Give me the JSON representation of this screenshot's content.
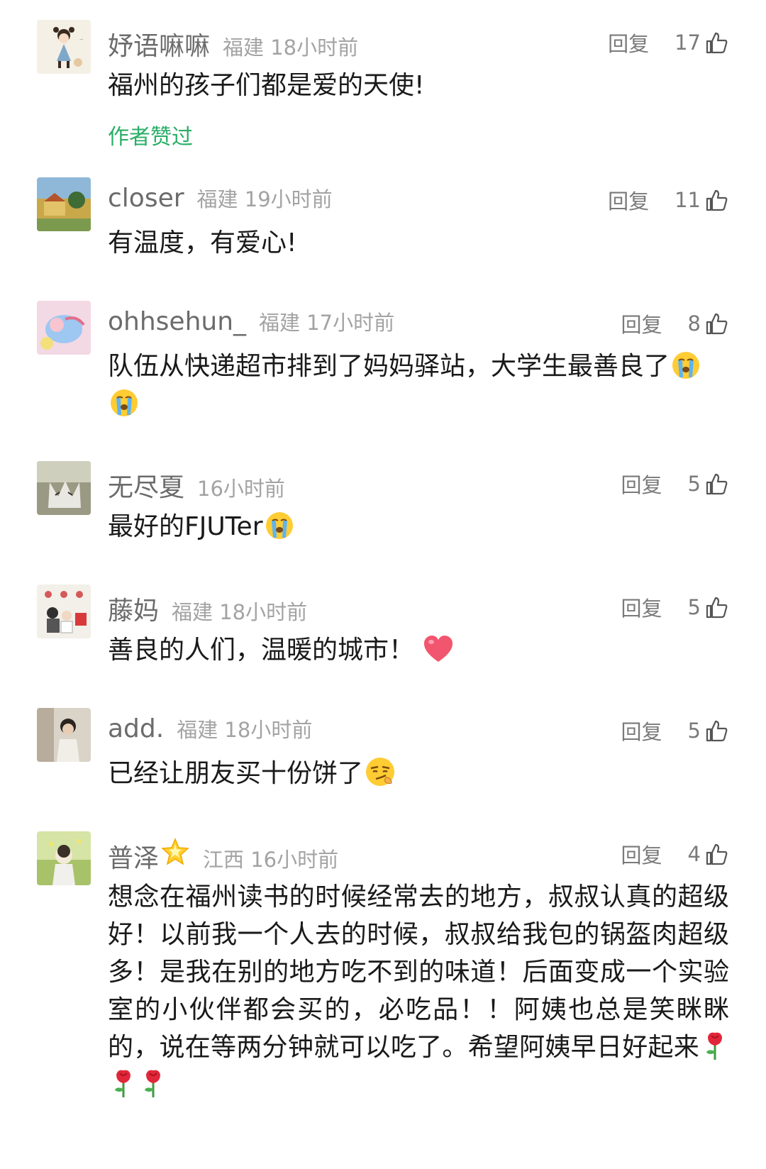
{
  "comments": [
    {
      "nick": "妤语嘛嘛",
      "meta": "福建 18小时前",
      "reply": "回复",
      "likes": "17",
      "text": "福州的孩子们都是爱的天使!",
      "liked": "作者赞过"
    },
    {
      "nick": "closer",
      "meta": "福建 19小时前",
      "reply": "回复",
      "likes": "11",
      "text": "有温度，有爱心!"
    },
    {
      "nick": "ohhsehun_",
      "meta": "福建 17小时前",
      "reply": "回复",
      "likes": "8",
      "text": "队伍从快递超市排到了妈妈驿站，大学生最善良了"
    },
    {
      "nick": "无尽夏",
      "meta": "16小时前",
      "reply": "回复",
      "likes": "5",
      "text": "最好的FJUTer"
    },
    {
      "nick": "藤妈",
      "meta": "福建 18小时前",
      "reply": "回复",
      "likes": "5",
      "text": "善良的人们，温暖的城市！"
    },
    {
      "nick": "add.",
      "meta": "福建 18小时前",
      "reply": "回复",
      "likes": "5",
      "text": "已经让朋友买十份饼了"
    },
    {
      "nick": "普泽",
      "meta": "江西 16小时前",
      "reply": "回复",
      "likes": "4",
      "text": "想念在福州读书的时候经常去的地方，叔叔认真的超级好！以前我一个人去的时候，叔叔给我包的锅盔肉超级多！是我在别的地方吃不到的味道！后面变成一个实验室的小伙伴都会买的，必吃品！！阿姨也总是笑眯眯的，说在等两分钟就可以吃了。希望阿姨早日好起来"
    }
  ],
  "icons": {
    "thumb": "thumbs-up-icon",
    "cry": "crying-face-emoji",
    "heart": "heart-emoji",
    "smirk": "smirk-face-emoji",
    "star": "star-emoji",
    "rose": "rose-emoji"
  },
  "colors": {
    "nick": "#6b6b6b",
    "meta": "#a3a3a3",
    "text": "#1a1a1a",
    "liked": "#2aae67",
    "heart": "#f2556e"
  }
}
